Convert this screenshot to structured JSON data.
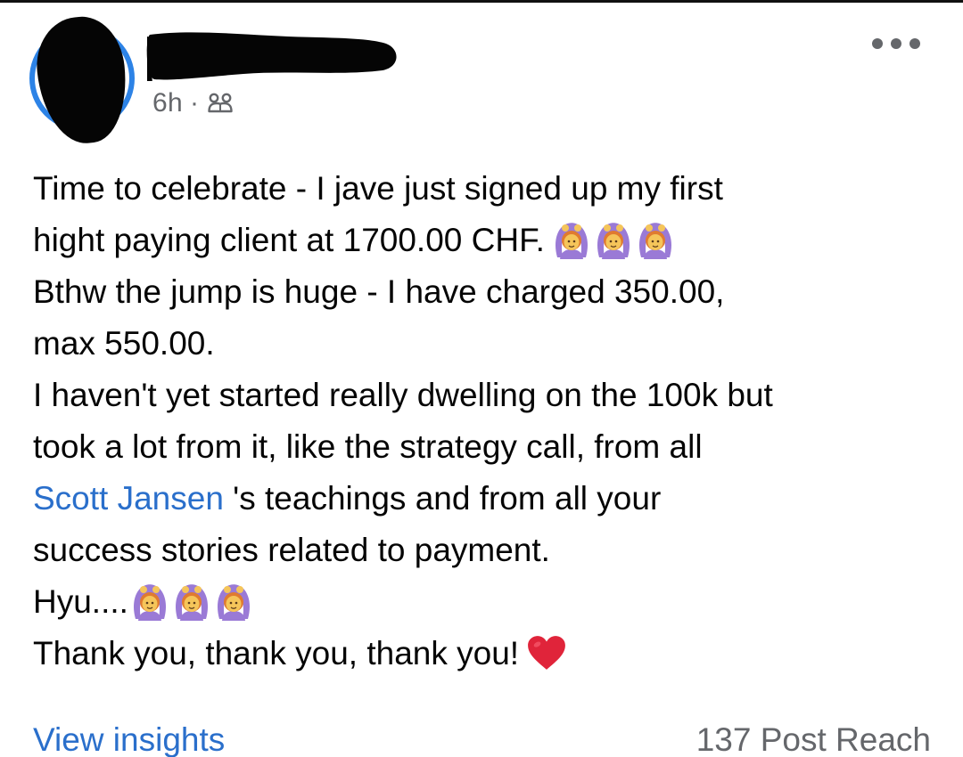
{
  "post": {
    "author_name": "",
    "timestamp": "6h",
    "separator": "·",
    "audience_icon": "friends-icon",
    "more_icon": "more-horizontal-icon",
    "text": {
      "line1": "Time to celebrate - I jave just signed up my first",
      "line2": "hight paying client at 1700.00 CHF.",
      "line3": "Bthw the jump is huge - I have charged 350.00,",
      "line4": "max 550.00.",
      "line5": "I haven't yet started really dwelling on the 100k but",
      "line6": "took a lot from it, like the strategy call, from all",
      "mention": "Scott Jansen",
      "line7_rest": " 's teachings and from all your",
      "line8": "success stories related to payment.",
      "line9": "Hyu....",
      "line10": "Thank you, thank you, thank you!"
    },
    "emojis": {
      "celebrate": "person-gesturing-ok-icon",
      "heart": "red-heart-icon"
    }
  },
  "footer": {
    "insights_label": "View insights",
    "reach_label": "137 Post Reach"
  },
  "colors": {
    "accent": "#2a6fcb",
    "avatar_ring": "#2d83e6",
    "meta_gray": "#65676b",
    "text": "#050505",
    "heart": "#e0243a",
    "emoji_purple": "#9a7ad6",
    "emoji_skin": "#f5c55a"
  }
}
